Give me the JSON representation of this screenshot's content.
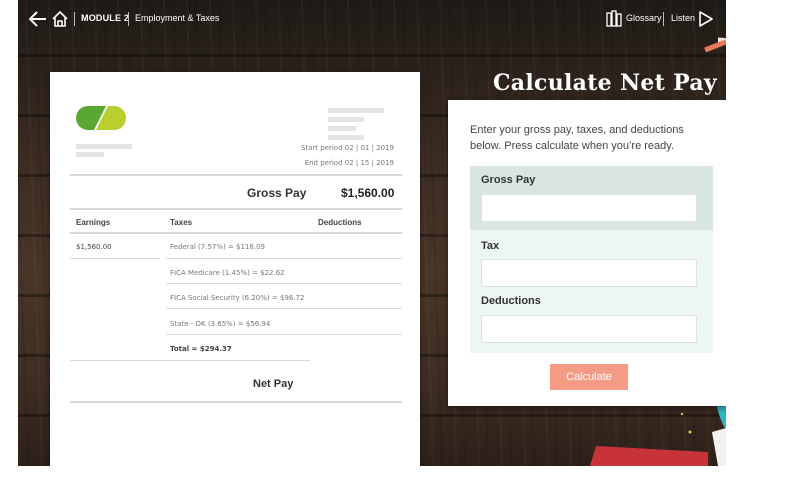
{
  "app": {
    "module_label": "MODULE 2",
    "module_title": "Employment & Taxes",
    "glossary_label": "Glossary",
    "listen_label": "Listen"
  },
  "stub": {
    "period_start": "Start period 02 | 01 | 2019",
    "period_end": "End period 02 | 15 | 2019",
    "gross_label": "Gross Pay",
    "gross_value": "$1,560.00",
    "headers": [
      "Earnings",
      "Taxes",
      "Deductions"
    ],
    "earnings": [
      "$1,560.00"
    ],
    "taxes": [
      "Federal (7.57%) = $118.09",
      "FICA Medicare (1.45%) = $22.62",
      "FICA Social Security (6.20%) = $96.72",
      "State - OK (3.65%) = $56.94"
    ],
    "taxes_total": "Total = $294.37",
    "net_label": "Net Pay"
  },
  "calculator": {
    "title": "Calculate Net Pay",
    "instructions": "Enter your gross pay, taxes, and deductions below. Press calculate when you’re ready.",
    "fields": [
      {
        "label": "Gross Pay",
        "value": ""
      },
      {
        "label": "Tax",
        "value": ""
      },
      {
        "label": "Deductions",
        "value": ""
      }
    ],
    "button_label": "Calculate"
  },
  "colors": {
    "accent_button": "#f49b86",
    "form_bg": "#ecf6f4",
    "logo_green": "#5aa832",
    "logo_lime": "#b8cf2e"
  },
  "icons": [
    "back-arrow-icon",
    "home-icon",
    "glossary-icon",
    "listen-play-icon"
  ]
}
